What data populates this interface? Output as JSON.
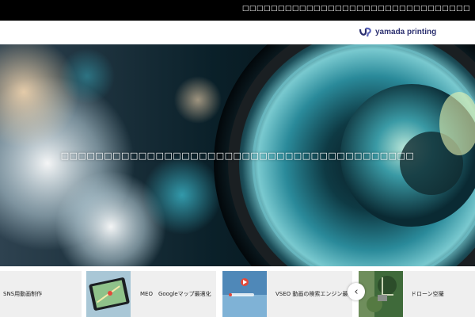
{
  "topbar": {
    "text": "□□□□□□□□□□□□□□□□□□□□□□□□□□□□□□□□"
  },
  "header": {
    "logo_icon": "yp-logo-icon",
    "brand_name": "yamada printing"
  },
  "hero": {
    "caption": "□□□□□□□□□□□□□□□□□□□□□□□□□□□□□□□□□□□□□□□□□"
  },
  "services": [
    {
      "label": "SNS用動画制作",
      "icon": ""
    },
    {
      "label": "MEO　Googleマップ最適化",
      "icon": "tablet-map-thumbnail"
    },
    {
      "label": "VSEO 動画の検索エンジン最適化",
      "icon": "video-search-thumbnail"
    },
    {
      "label": "ドローン空撮",
      "icon": "drone-aerial-thumbnail"
    }
  ],
  "carousel": {
    "prev_icon": "chevron-left-icon",
    "prev_glyph": "‹"
  },
  "colors": {
    "topbar": "#000000",
    "brand": "#2c3070",
    "card_bg": "#efefef"
  }
}
